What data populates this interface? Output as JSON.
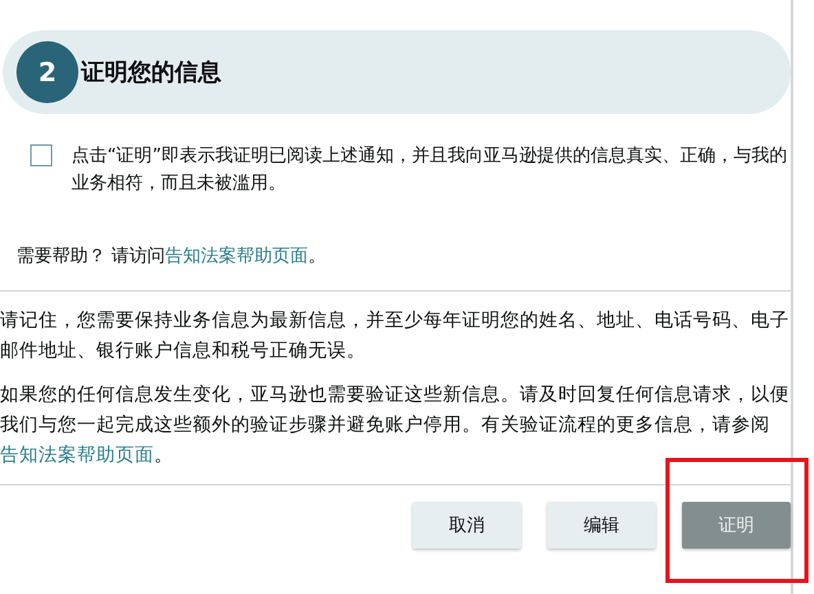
{
  "step": {
    "number": "2",
    "title": "证明您的信息"
  },
  "attestation": {
    "checked": false,
    "text": "点击“证明”即表示我证明已阅读上述通知，并且我向亚马逊提供的信息真实、正确，与我的业务相符，而且未被滥用。"
  },
  "help": {
    "text": "需要帮助？ 请访问",
    "link": "告知法案帮助页面",
    "suffix": "。"
  },
  "paragraphs": [
    {
      "text": "请记住，您需要保持业务信息为最新信息，并至少每年证明您的姓名、地址、电话号码、电子邮件地址、银行账户信息和税号正确无误。"
    },
    {
      "text": "如果您的任何信息发生变化，亚马逊也需要验证这些新信息。请及时回复任何信息请求，以便我们与您一起完成这些额外的验证步骤并避免账户停用。有关验证流程的更多信息，请参阅",
      "link": "告知法案帮助页面",
      "suffix": "。"
    }
  ],
  "buttons": [
    {
      "label": "取消",
      "kind": "secondary",
      "disabled": false,
      "highlighted": false
    },
    {
      "label": "编辑",
      "kind": "secondary",
      "disabled": false,
      "highlighted": false
    },
    {
      "label": "证明",
      "kind": "primary",
      "disabled": true,
      "highlighted": true
    }
  ]
}
